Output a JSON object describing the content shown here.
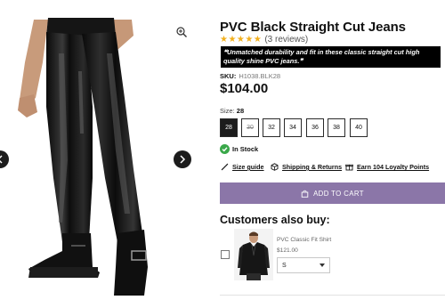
{
  "product": {
    "title": "PVC Black Straight Cut Jeans",
    "stars": "★★★★★",
    "reviews": "(3 reviews)",
    "tagline": "❝Unmatched durability and fit in these classic straight cut high quality shine PVC jeans.❞",
    "sku_label": "SKU:",
    "sku_value": "H1038.BLK28",
    "price": "$104.00",
    "rating_color": "#f2b01e"
  },
  "sizes": {
    "label": "Size:",
    "selected_value": "28",
    "options": [
      {
        "label": "28",
        "state": "selected"
      },
      {
        "label": "30",
        "state": "unavailable"
      },
      {
        "label": "32",
        "state": "available"
      },
      {
        "label": "34",
        "state": "available"
      },
      {
        "label": "36",
        "state": "available"
      },
      {
        "label": "38",
        "state": "available"
      },
      {
        "label": "40",
        "state": "available"
      }
    ]
  },
  "stock": {
    "text": "In Stock",
    "color": "#3aa84a"
  },
  "links": {
    "size_guide": "Size guide",
    "shipping": "Shipping & Returns",
    "loyalty": "Earn 104 Loyalty Points"
  },
  "cart": {
    "label": "ADD TO CART",
    "color": "#8b76a8"
  },
  "upsell": {
    "heading": "Customers also buy:",
    "name": "PVC Classic Fit Shirt",
    "price": "$121.00",
    "size_value": "S"
  },
  "icons": {
    "gallery": [
      "zoom-icon",
      "chevron-left-icon",
      "chevron-right-icon"
    ],
    "links": [
      "ruler-icon",
      "box-icon",
      "gift-icon"
    ],
    "cart": "shopping-bag-icon",
    "stock": "check-icon"
  }
}
